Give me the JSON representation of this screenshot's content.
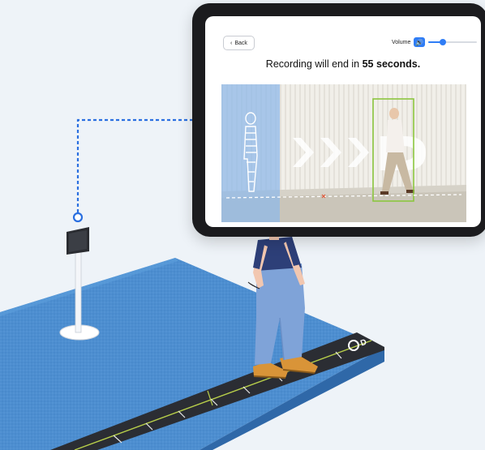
{
  "tablet": {
    "back_button": "Back",
    "volume": {
      "label": "Volume",
      "level": 0.3
    },
    "recording_message": {
      "prefix": "Recording will end in ",
      "countdown": "55 seconds."
    }
  },
  "colors": {
    "accent": "#2f7df6",
    "connector": "#2a6fe0",
    "mat": "#4d8ed0",
    "walkway": "#2b2d33",
    "center_line": "#b8cf4a",
    "tracking_box": "#8cc63f"
  },
  "icons": {
    "back": "chevron-left-icon",
    "volume": "speaker-icon",
    "mat_logo": "brand-logo-icon"
  }
}
